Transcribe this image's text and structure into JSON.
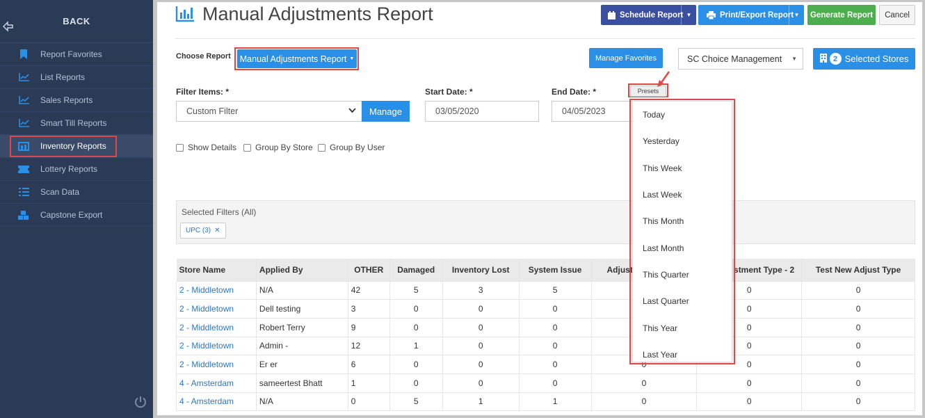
{
  "sidebar": {
    "back_label": "BACK",
    "items": [
      {
        "label": "Report Favorites",
        "icon": "bookmark-icon"
      },
      {
        "label": "List Reports",
        "icon": "line-chart-icon"
      },
      {
        "label": "Sales Reports",
        "icon": "line-chart-icon"
      },
      {
        "label": "Smart Till Reports",
        "icon": "line-chart-icon"
      },
      {
        "label": "Inventory Reports",
        "icon": "inventory-icon"
      },
      {
        "label": "Lottery Reports",
        "icon": "ticket-icon"
      },
      {
        "label": "Scan Data",
        "icon": "list-icon"
      },
      {
        "label": "Capstone Export",
        "icon": "boxes-icon"
      }
    ]
  },
  "header": {
    "title": "Manual Adjustments Report",
    "schedule_label": "Schedule Report",
    "print_label": "Print/Export Report",
    "generate_label": "Generate Report",
    "cancel_label": "Cancel"
  },
  "controls": {
    "choose_report_label": "Choose Report",
    "report_value": "Manual Adjustments Report",
    "manage_favorites_label": "Manage Favorites",
    "company_value": "SC Choice Management",
    "selected_stores_count": "2",
    "selected_stores_label": "Selected Stores",
    "filter_items_label": "Filter Items: *",
    "filter_value": "Custom Filter",
    "manage_label": "Manage",
    "start_date_label": "Start Date: *",
    "start_date_value": "03/05/2020",
    "end_date_label": "End Date: *",
    "end_date_value": "04/05/2023",
    "presets_label": "Presets",
    "checkboxes": [
      "Show Details",
      "Group By Store",
      "Group By User"
    ]
  },
  "filters": {
    "title": "Selected Filters (All)",
    "tag": "UPC (3)"
  },
  "presets_menu": [
    "Today",
    "Yesterday",
    "This Week",
    "Last Week",
    "This Month",
    "Last Month",
    "This Quarter",
    "Last Quarter",
    "This Year",
    "Last Year"
  ],
  "table": {
    "headers": [
      "Store Name",
      "Applied By",
      "OTHER",
      "Damaged",
      "Inventory Lost",
      "System Issue",
      "Adjust",
      "stment Type - 2",
      "Test New Adjust Type"
    ],
    "rows": [
      [
        "2 - Middletown",
        "N/A",
        "42",
        "5",
        "3",
        "5",
        "",
        "0",
        "0"
      ],
      [
        "2 - Middletown",
        "Dell testing",
        "3",
        "0",
        "0",
        "0",
        "",
        "0",
        "0"
      ],
      [
        "2 - Middletown",
        "Robert Terry",
        "9",
        "0",
        "0",
        "0",
        "",
        "0",
        "0"
      ],
      [
        "2 - Middletown",
        "Admin -",
        "12",
        "1",
        "0",
        "0",
        "",
        "0",
        "0"
      ],
      [
        "2 - Middletown",
        "Er er",
        "6",
        "0",
        "0",
        "0",
        "0",
        "0",
        "0"
      ],
      [
        "4 - Amsterdam",
        "sameertest Bhatt",
        "1",
        "0",
        "0",
        "0",
        "0",
        "0",
        "0"
      ],
      [
        "4 - Amsterdam",
        "N/A",
        "0",
        "5",
        "1",
        "1",
        "0",
        "0",
        "0"
      ]
    ]
  }
}
